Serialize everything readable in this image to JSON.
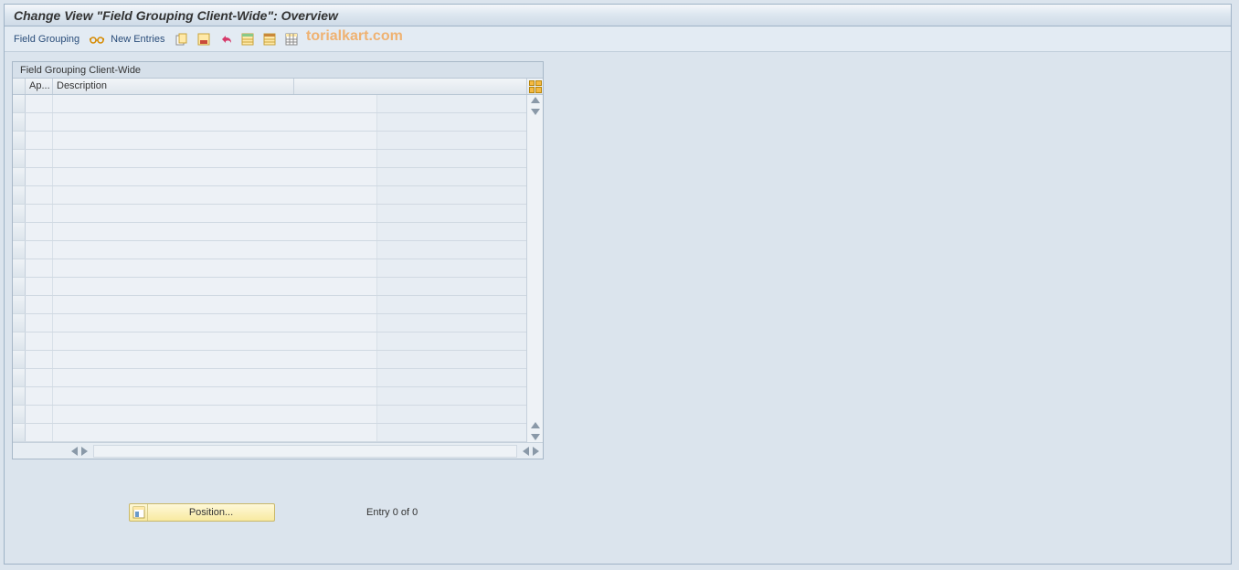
{
  "window": {
    "title": "Change View \"Field Grouping Client-Wide\": Overview"
  },
  "toolbar": {
    "field_grouping_label": "Field Grouping",
    "new_entries_label": "New Entries"
  },
  "watermark": "torialkart.com",
  "panel": {
    "title": "Field Grouping Client-Wide",
    "columns": {
      "ap": "Ap...",
      "description": "Description"
    },
    "row_count": 19
  },
  "footer": {
    "position_label": "Position...",
    "entry_text": "Entry 0 of 0"
  }
}
